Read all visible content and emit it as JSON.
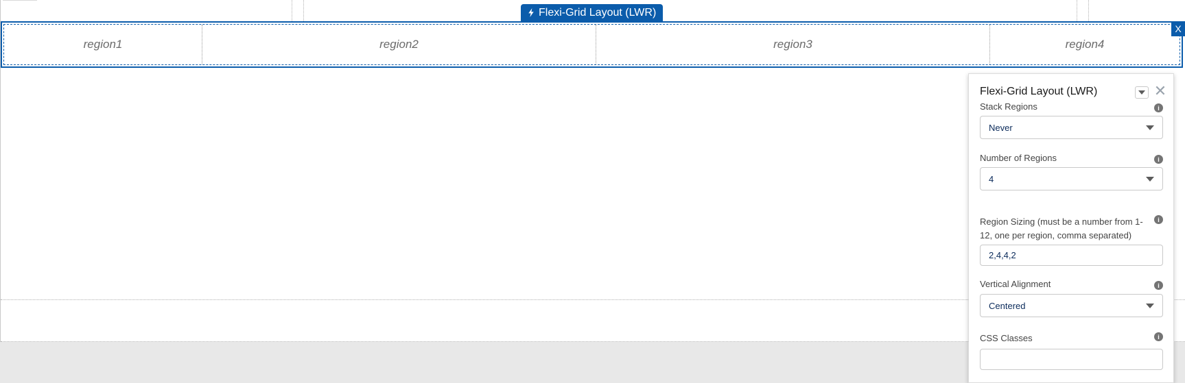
{
  "component_label": "Flexi-Grid Layout (LWR)",
  "close_label": "X",
  "regions": [
    "region1",
    "region2",
    "region3",
    "region4"
  ],
  "panel": {
    "title": "Flexi-Grid Layout (LWR)",
    "close_glyph": "✕",
    "fields": {
      "stack_regions": {
        "label": "Stack Regions",
        "value": "Never"
      },
      "number_of_regions": {
        "label": "Number of Regions",
        "value": "4"
      },
      "region_sizing": {
        "label": "Region Sizing (must be a number from 1-12, one per region, comma separated)",
        "value": "2,4,4,2"
      },
      "vertical_alignment": {
        "label": "Vertical Alignment",
        "value": "Centered"
      },
      "css_classes": {
        "label": "CSS Classes",
        "value": ""
      }
    }
  },
  "colors": {
    "accent": "#0b5cab",
    "region_text": "#6b6b6b",
    "footer": "#e8e8e8"
  },
  "icons": {
    "label_icon": "lightning-bolt-icon",
    "info": "info-icon",
    "dropdown": "chevron-down-icon"
  }
}
